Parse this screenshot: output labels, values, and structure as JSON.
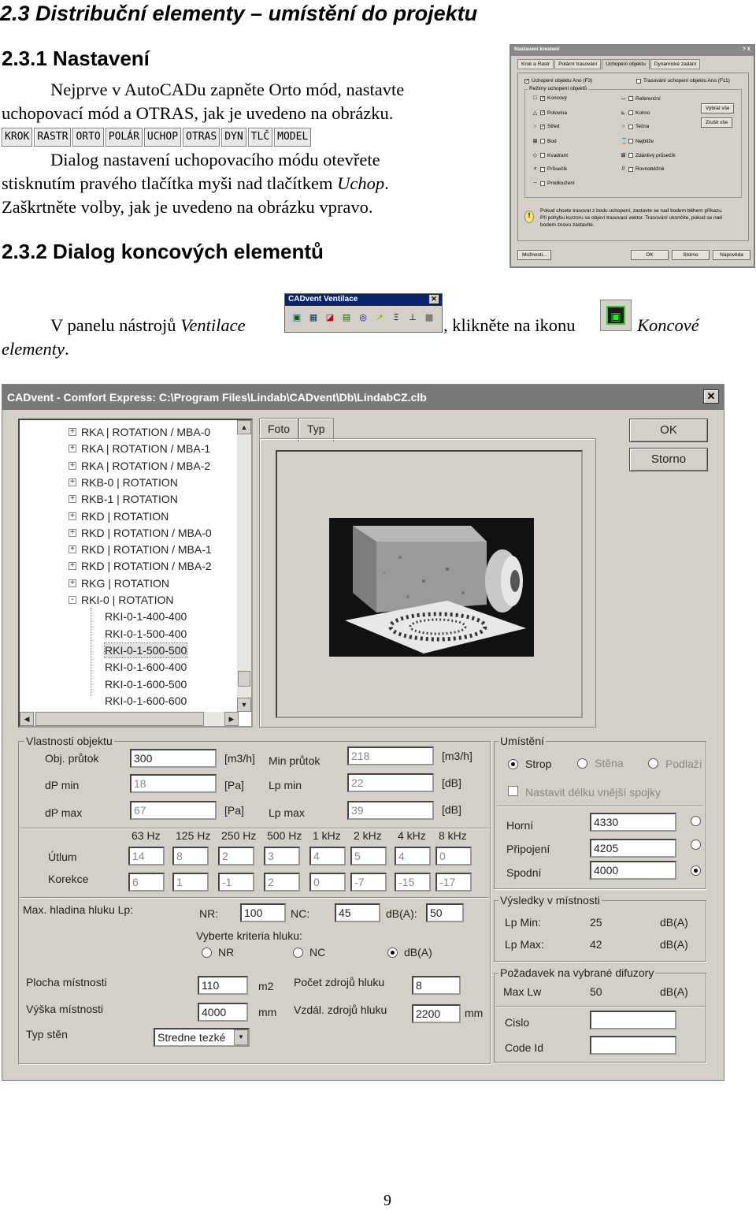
{
  "heading": "2.3 Distribuční elementy – umístění do projektu",
  "sec1": {
    "title": "2.3.1 Nastavení",
    "para1_line1": "Nejprve v AutoCADu zapněte Orto mód, nastavte",
    "para1_line2": "uchopovací mód a OTRAS, jak je uvedeno na obrázku.",
    "statusbar": [
      "KROK",
      "RASTR",
      "ORTO",
      "POLÁR",
      "UCHOP",
      "OTRAS",
      "DYN",
      "TLČ",
      "MODEL"
    ],
    "para2_line1": "Dialog nastavení uchopovacího módu otevřete",
    "para2_line2_a": "stisknutím pravého tlačítka myši nad tlačítkem ",
    "para2_line2_b": "Uchop",
    "para2_line2_c": ".",
    "para2_line3": "Zaškrtněte volby, jak je uvedeno na obrázku vpravo."
  },
  "osnap": {
    "title": "Nastavení kreslení",
    "tabs": [
      "Krok a Rastr",
      "Polární trasování",
      "Uchopení objektu",
      "Dynamické zadání"
    ],
    "chk_on": "Uchopení objektu Ano (F3)",
    "chk_track": "Trasování uchopení objektu Ano (F11)",
    "group": "Režimy uchopení objektů",
    "left": [
      {
        "label": "Koncový",
        "checked": true,
        "sym": "□"
      },
      {
        "label": "Polovina",
        "checked": true,
        "sym": "△"
      },
      {
        "label": "Střed",
        "checked": true,
        "sym": "○"
      },
      {
        "label": "Bod",
        "checked": false,
        "sym": "⊠"
      },
      {
        "label": "Kvadrant",
        "checked": false,
        "sym": "◇"
      },
      {
        "label": "Průsečík",
        "checked": false,
        "sym": "×"
      },
      {
        "label": "Prodloužení",
        "checked": false,
        "sym": "--"
      }
    ],
    "right": [
      {
        "label": "Referenční",
        "checked": false,
        "sym": "⌴"
      },
      {
        "label": "Kolmo",
        "checked": false,
        "sym": "⊾"
      },
      {
        "label": "Tečna",
        "checked": false,
        "sym": "○"
      },
      {
        "label": "Nejbliže",
        "checked": false,
        "sym": "⌛"
      },
      {
        "label": "Zdánlivý průsečík",
        "checked": false,
        "sym": "⊠"
      },
      {
        "label": "Rovnoběžně",
        "checked": false,
        "sym": "//"
      }
    ],
    "btn_all": "Vybrat vše",
    "btn_none": "Zrušit vše",
    "note": "Pokud chcete trasovat z bodu uchopení, zastavte se nad bodem během příkazu. Při pohybu kurzoru se objeví trasovací vektor. Trasování ukončíte, pokud se nad bodem znovu zastavíte.",
    "btn_options": "Možnosti...",
    "btn_ok": "OK",
    "btn_cancel": "Storno",
    "btn_help": "Nápověda"
  },
  "sec2": {
    "title": "2.3.2 Dialog koncových elementů",
    "text_a": "V panelu nástrojů ",
    "text_b": "Ventilace",
    "text_c": ", klikněte na ikonu",
    "text_d": "Koncové",
    "text_e": "elementy",
    "text_f": ".",
    "toolbar_title": "CADvent Ventilace"
  },
  "dialog": {
    "title": "CADvent - Comfort Express: C:\\Program Files\\Lindab\\CADvent\\Db\\LindabCZ.clb",
    "tree": [
      {
        "label": "RKA | ROTATION / MBA-0",
        "level": 0,
        "pm": "+"
      },
      {
        "label": "RKA | ROTATION / MBA-1",
        "level": 0,
        "pm": "+"
      },
      {
        "label": "RKA | ROTATION / MBA-2",
        "level": 0,
        "pm": "+"
      },
      {
        "label": "RKB-0 | ROTATION",
        "level": 0,
        "pm": "+"
      },
      {
        "label": "RKB-1 | ROTATION",
        "level": 0,
        "pm": "+"
      },
      {
        "label": "RKD | ROTATION",
        "level": 0,
        "pm": "+"
      },
      {
        "label": "RKD | ROTATION / MBA-0",
        "level": 0,
        "pm": "+"
      },
      {
        "label": "RKD | ROTATION / MBA-1",
        "level": 0,
        "pm": "+"
      },
      {
        "label": "RKD | ROTATION / MBA-2",
        "level": 0,
        "pm": "+"
      },
      {
        "label": "RKG | ROTATION",
        "level": 0,
        "pm": "+"
      },
      {
        "label": "RKI-0 | ROTATION",
        "level": 0,
        "pm": "-"
      },
      {
        "label": "RKI-0-1-400-400",
        "level": 1
      },
      {
        "label": "RKI-0-1-500-400",
        "level": 1
      },
      {
        "label": "RKI-0-1-500-500",
        "level": 1,
        "selected": true
      },
      {
        "label": "RKI-0-1-600-400",
        "level": 1
      },
      {
        "label": "RKI-0-1-600-500",
        "level": 1
      },
      {
        "label": "RKI-0-1-600-600",
        "level": 1
      }
    ],
    "tabs": [
      "Foto",
      "Typ"
    ],
    "btn_ok": "OK",
    "btn_cancel": "Storno",
    "props": {
      "group": "Vlastnosti objektu",
      "obj_prutok_lbl": "Obj. průtok",
      "obj_prutok": "300",
      "obj_prutok_unit": "[m3/h]",
      "min_prutok_lbl": "Min průtok",
      "min_prutok": "218",
      "min_prutok_unit": "[m3/h]",
      "dpmin_lbl": "dP min",
      "dpmin": "18",
      "dpmin_unit": "[Pa]",
      "lpmin_lbl": "Lp min",
      "lpmin": "22",
      "lpmin_unit": "[dB]",
      "dpmax_lbl": "dP max",
      "dpmax": "67",
      "dpmax_unit": "[Pa]",
      "lpmax_lbl": "Lp max",
      "lpmax": "39",
      "lpmax_unit": "[dB]",
      "freqs": [
        "63 Hz",
        "125 Hz",
        "250 Hz",
        "500 Hz",
        "1 kHz",
        "2 kHz",
        "4 kHz",
        "8 kHz"
      ],
      "utlum_lbl": "Útlum",
      "utlum": [
        "14",
        "8",
        "2",
        "3",
        "4",
        "5",
        "4",
        "0"
      ],
      "korekce_lbl": "Korekce",
      "korekce": [
        "6",
        "1",
        "-1",
        "2",
        "0",
        "-7",
        "-15",
        "-17"
      ],
      "maxhl_lbl": "Max. hladina hluku Lp:",
      "nr_lbl": "NR:",
      "nr": "100",
      "nc_lbl": "NC:",
      "nc": "45",
      "dba_lbl": "dB(A):",
      "dba": "50",
      "criteria_lbl": "Vyberte kriteria hluku:",
      "crit_nr": "NR",
      "crit_nc": "NC",
      "crit_dba": "dB(A)",
      "plocha_lbl": "Plocha místnosti",
      "plocha": "110",
      "plocha_unit": "m2",
      "pocet_lbl": "Počet zdrojů hluku",
      "pocet": "8",
      "vyska_lbl": "Výška místnosti",
      "vyska": "4000",
      "vyska_unit": "mm",
      "vzdal_lbl": "Vzdál. zdrojů hluku",
      "vzdal": "2200",
      "vzdal_unit": "mm",
      "typsten_lbl": "Typ stěn",
      "typsten": "Stredne tezké"
    },
    "place": {
      "group": "Umístění",
      "strop": "Strop",
      "stena": "Stěna",
      "podlaha": "Podlaží",
      "nastavit": "Nastavit délku vnější spojky",
      "horni_lbl": "Horní",
      "horni": "4330",
      "pripojeni_lbl": "Připojení",
      "pripojeni": "4205",
      "spodni_lbl": "Spodní",
      "spodni": "4000"
    },
    "results": {
      "group": "Výsledky v místnosti",
      "lpmin_lbl": "Lp Min:",
      "lpmin": "25",
      "lpmin_unit": "dB(A)",
      "lpmax_lbl": "Lp Max:",
      "lpmax": "42",
      "lpmax_unit": "dB(A)"
    },
    "req": {
      "group": "Požadavek na vybrané difuzory",
      "maxlw_lbl": "Max Lw",
      "maxlw": "50",
      "maxlw_unit": "dB(A)",
      "cislo_lbl": "Cislo",
      "cislo": "",
      "codeid_lbl": "Code Id",
      "codeid": ""
    }
  },
  "page_number": "9"
}
